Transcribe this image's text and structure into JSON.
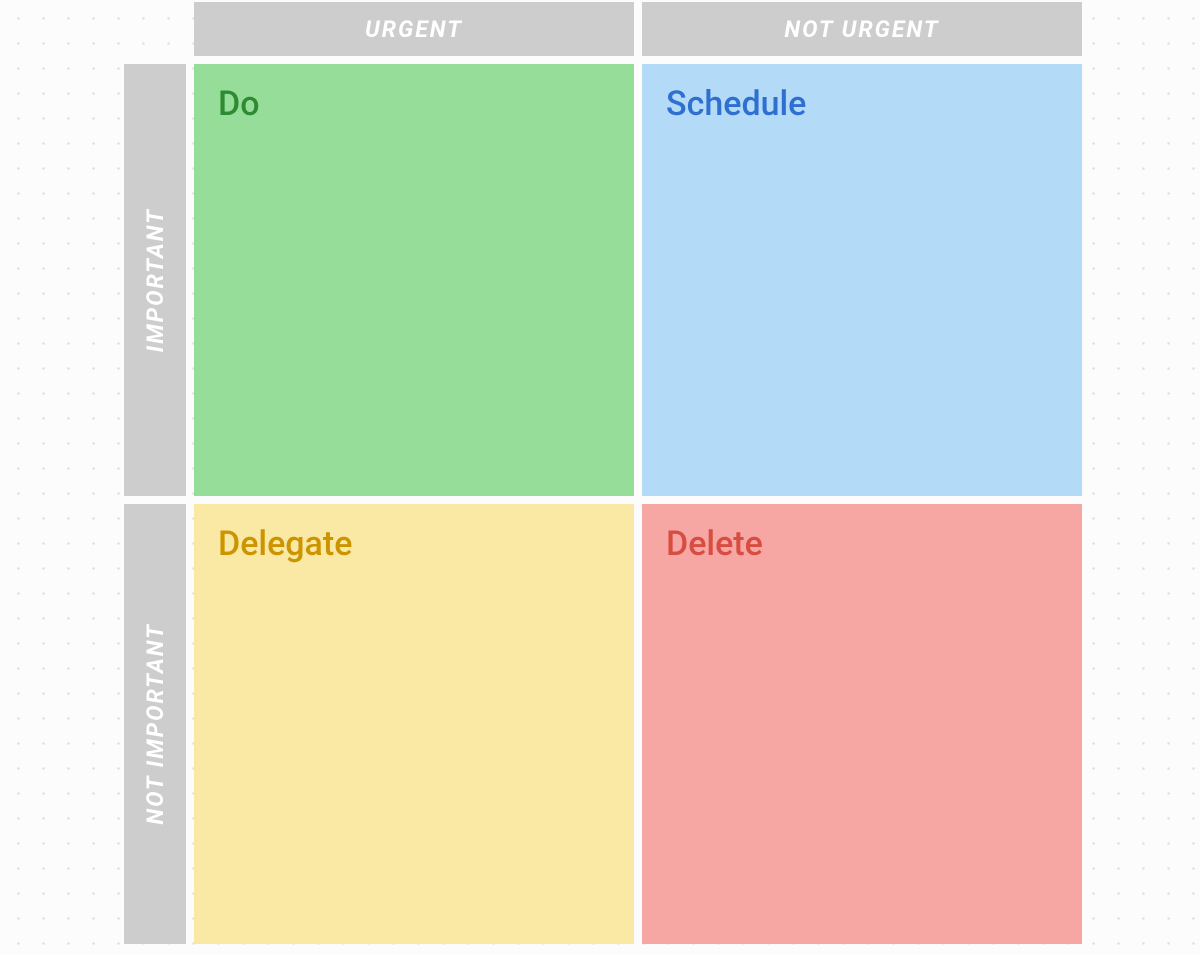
{
  "columns": {
    "urgent": "URGENT",
    "not_urgent": "NOT URGENT"
  },
  "rows": {
    "important": "IMPORTANT",
    "not_important": "NOT IMPORTANT"
  },
  "quadrants": {
    "do": {
      "title": "Do",
      "color": "#96dd99",
      "text_color": "#2e8b32"
    },
    "schedule": {
      "title": "Schedule",
      "color": "#b3daf7",
      "text_color": "#2f6fd0"
    },
    "delegate": {
      "title": "Delegate",
      "color": "#fae8a5",
      "text_color": "#cc9500"
    },
    "delete": {
      "title": "Delete",
      "color": "#f6a6a3",
      "text_color": "#d84d42"
    }
  }
}
